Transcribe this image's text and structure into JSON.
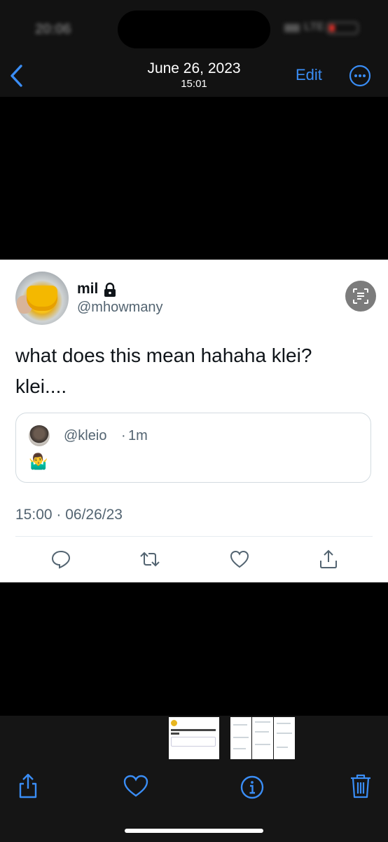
{
  "status_bar": {
    "time": "20:06"
  },
  "header": {
    "date": "June 26, 2023",
    "time": "15:01",
    "edit_label": "Edit"
  },
  "tweet": {
    "display_name": "mil",
    "handle": "@mhowmany",
    "text": "what does this mean hahaha klei? klei....",
    "quoted": {
      "handle": "@kleio",
      "separator": "·",
      "age": "1m",
      "body": "🤷‍♂️"
    },
    "timestamp": "15:00 · 06/26/23"
  },
  "tweet_actions": [
    "reply-icon",
    "retweet-icon",
    "like-icon",
    "share-icon",
    "live-text-icon"
  ],
  "toolbar": [
    "share-icon",
    "heart-icon",
    "info-icon",
    "trash-icon"
  ],
  "colors": {
    "accent": "#3a8df5",
    "text": "#0f1419",
    "secondary": "#536471",
    "toolbar_bg": "#151515"
  }
}
